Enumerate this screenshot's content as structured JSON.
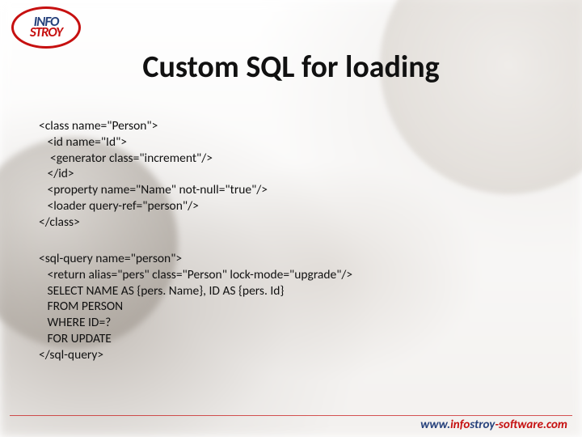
{
  "logo": {
    "line1": "INFO",
    "line2": "STROY"
  },
  "title": "Custom SQL for loading",
  "code_block_1": "<class name=\"Person\">\n   <id name=\"Id\">\n    <generator class=\"increment\"/>\n   </id>\n   <property name=\"Name\" not-null=\"true\"/>\n   <loader query-ref=\"person\"/>\n</class>",
  "code_block_2": "<sql-query name=\"person\">\n   <return alias=\"pers\" class=\"Person\" lock-mode=\"upgrade\"/>\n   SELECT NAME AS {pers. Name}, ID AS {pers. Id}\n   FROM PERSON\n   WHERE ID=?\n   FOR UPDATE\n</sql-query>",
  "footer": {
    "www": "www.",
    "info": "info",
    "stroy": "stroy",
    "tail": "-software.com"
  }
}
